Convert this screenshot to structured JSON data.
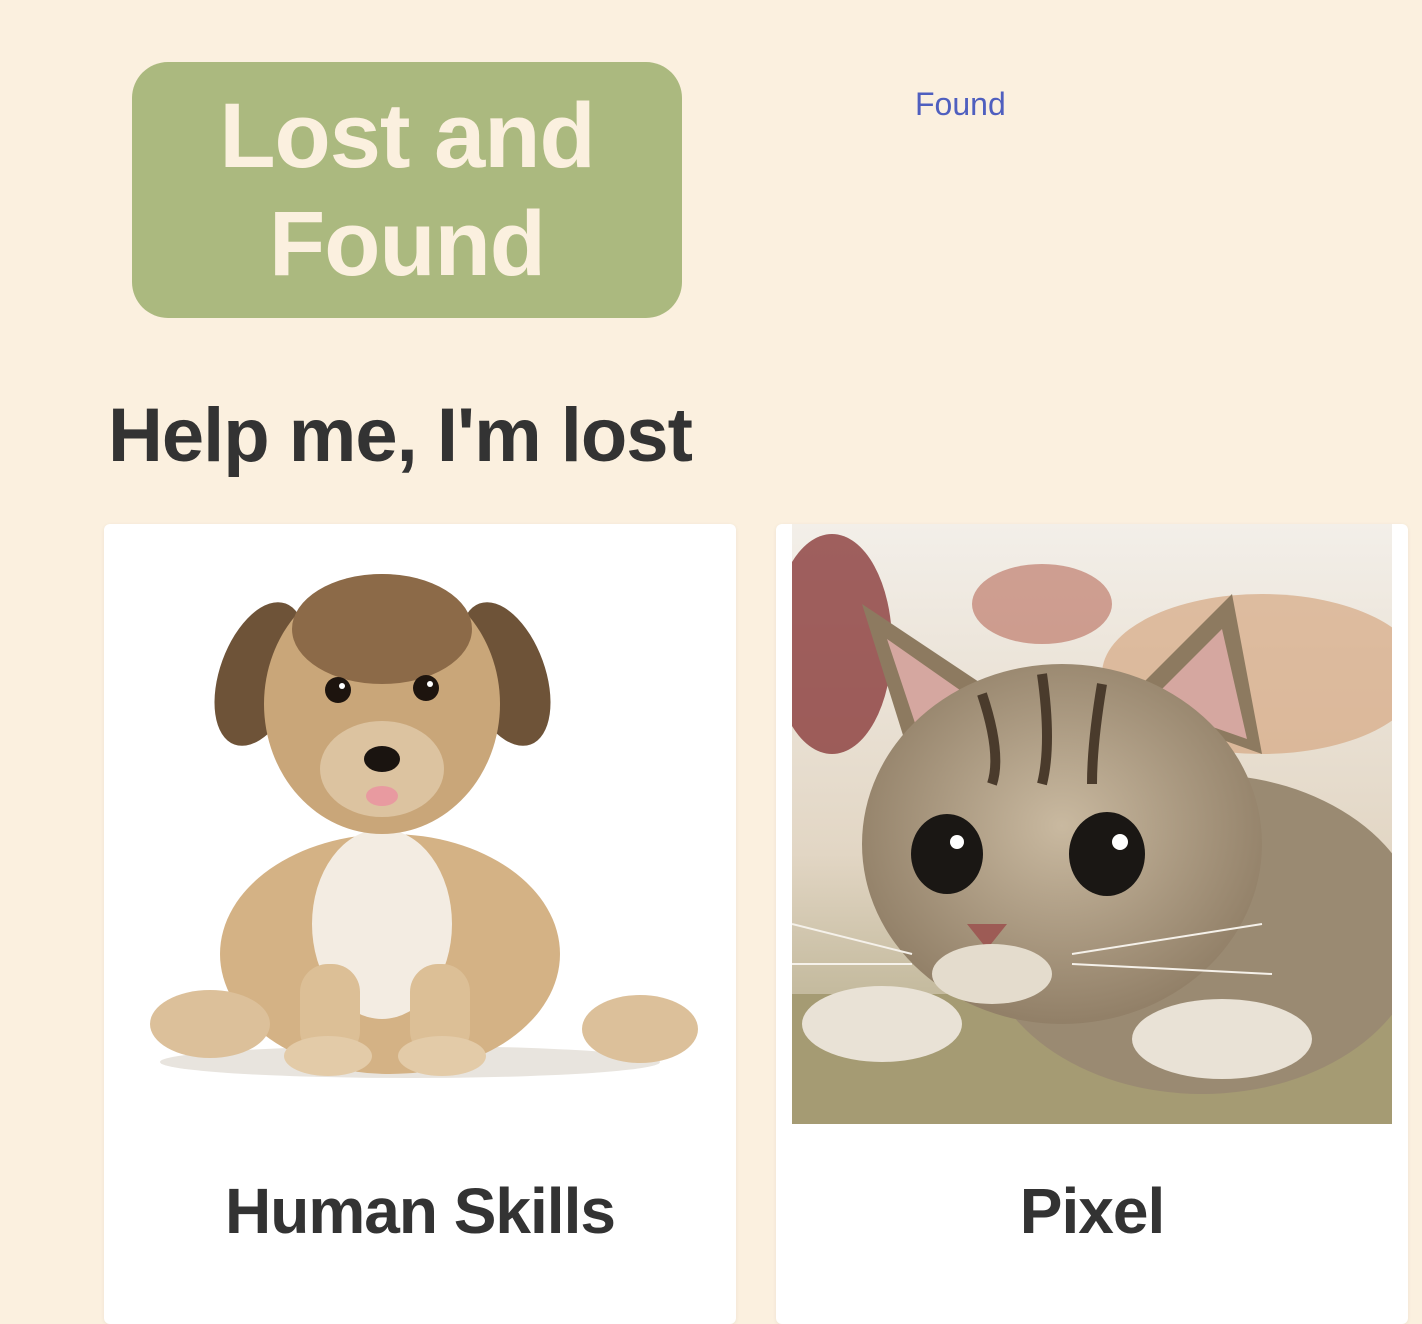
{
  "header": {
    "logo_text": "Lost and Found",
    "nav": {
      "found_label": "Found"
    }
  },
  "main": {
    "section_title": "Help me, I'm lost",
    "pets": [
      {
        "name": "Human Skills",
        "photo_icon": "puppy-photo"
      },
      {
        "name": "Pixel",
        "photo_icon": "kitten-photo"
      }
    ]
  },
  "colors": {
    "page_background": "#fbf0df",
    "logo_background": "#abb97f",
    "logo_text": "#fbf0df",
    "link": "#4f5fbf",
    "heading_text": "#333333",
    "card_background": "#ffffff"
  }
}
